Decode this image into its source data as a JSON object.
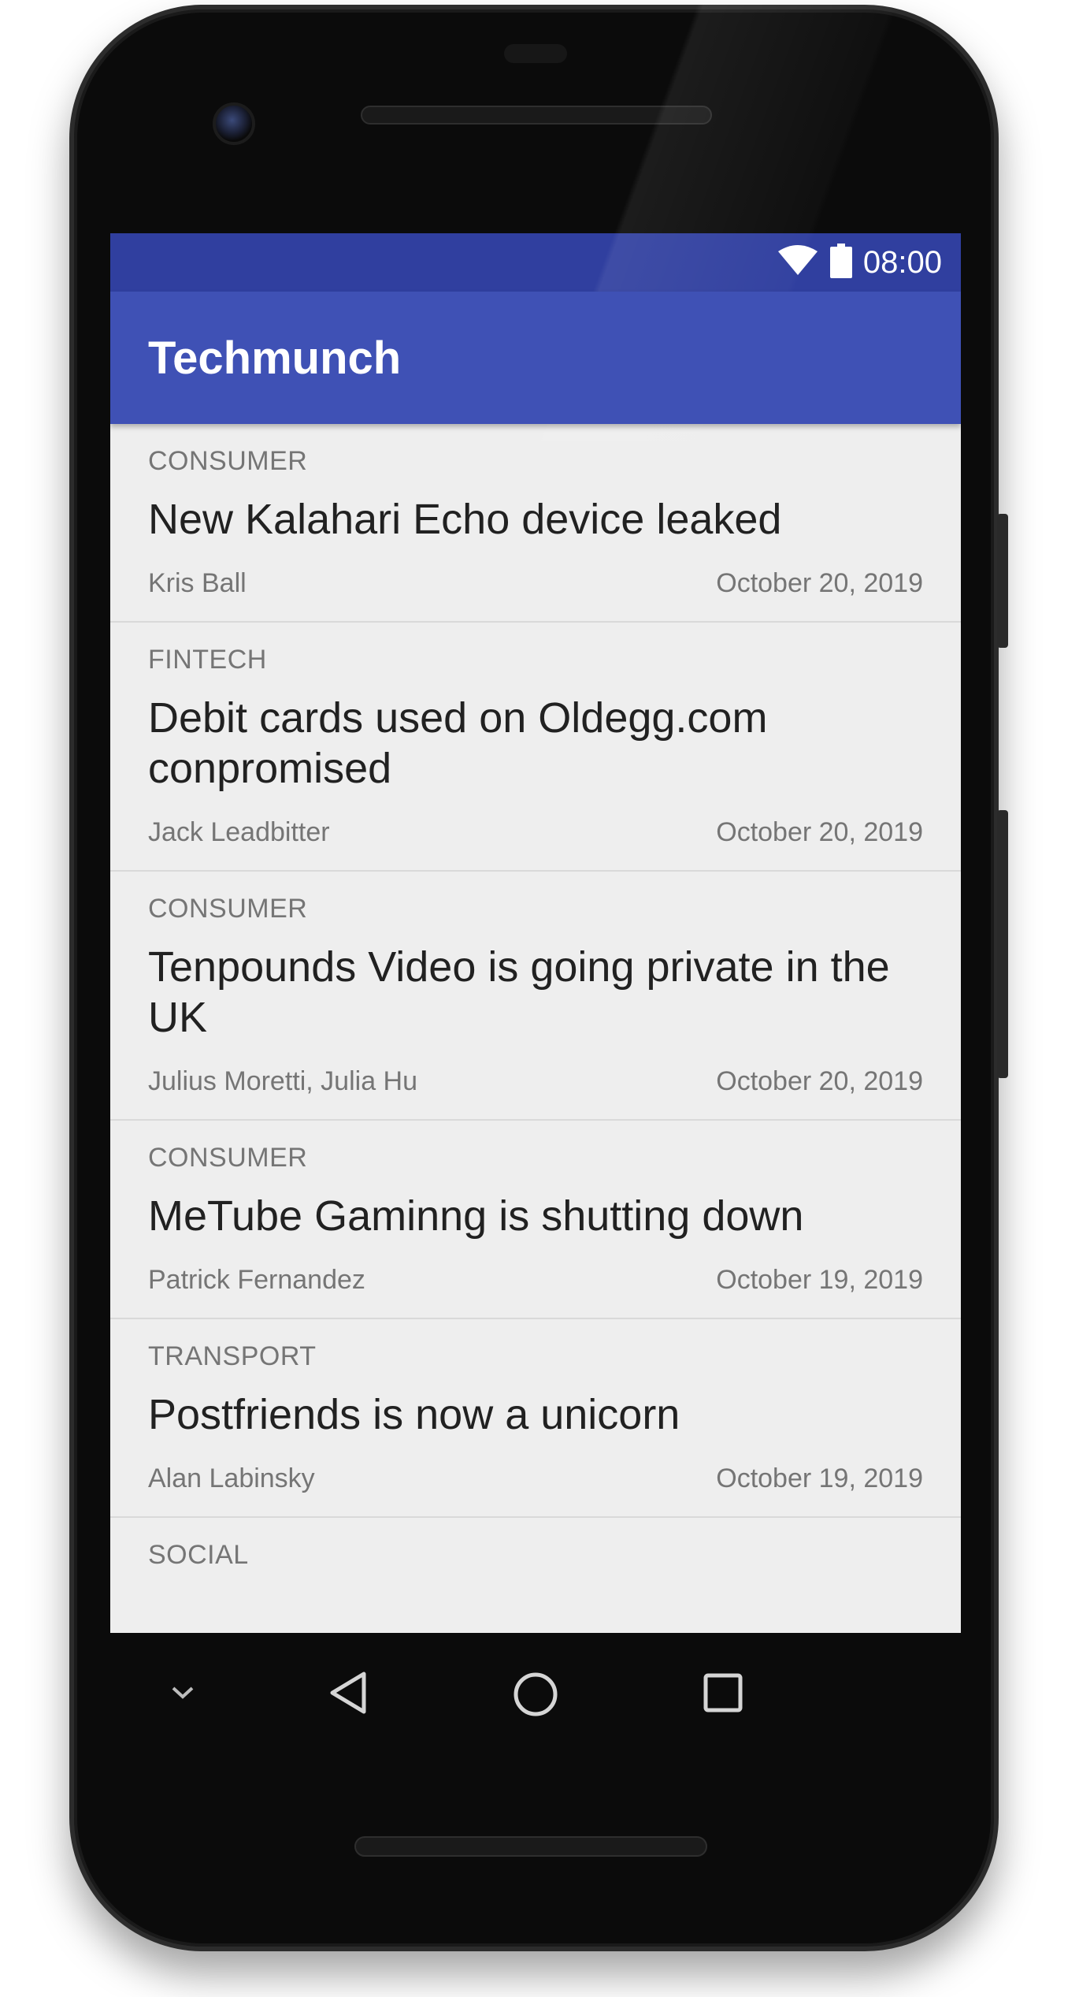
{
  "status_bar": {
    "time": "08:00",
    "wifi_icon": "wifi-icon",
    "battery_icon": "battery-icon"
  },
  "app_bar": {
    "title": "Techmunch"
  },
  "articles": [
    {
      "category": "CONSUMER",
      "headline": "New Kalahari Echo device leaked",
      "author": "Kris Ball",
      "date": "October 20, 2019"
    },
    {
      "category": "FINTECH",
      "headline": "Debit cards used on Oldegg.com conpromised",
      "author": "Jack Leadbitter",
      "date": "October 20, 2019"
    },
    {
      "category": "CONSUMER",
      "headline": "Tenpounds Video is going private in the UK",
      "author": "Julius Moretti, Julia Hu",
      "date": "October 20, 2019"
    },
    {
      "category": "CONSUMER",
      "headline": "MeTube Gaminng is shutting down",
      "author": "Patrick Fernandez",
      "date": "October 19, 2019"
    },
    {
      "category": "TRANSPORT",
      "headline": "Postfriends is now a unicorn",
      "author": "Alan Labinsky",
      "date": "October 19, 2019"
    },
    {
      "category": "SOCIAL"
    }
  ],
  "nav_bar": {
    "keyboard_hide_icon": "chevron-down-icon",
    "back_icon": "back-triangle-icon",
    "home_icon": "home-circle-icon",
    "recents_icon": "recents-square-icon"
  },
  "colors": {
    "status_bar": "#303f9f",
    "app_bar": "#3f51b5",
    "list_background": "#eeeeee",
    "headline_text": "#212121",
    "secondary_text": "#757575"
  }
}
